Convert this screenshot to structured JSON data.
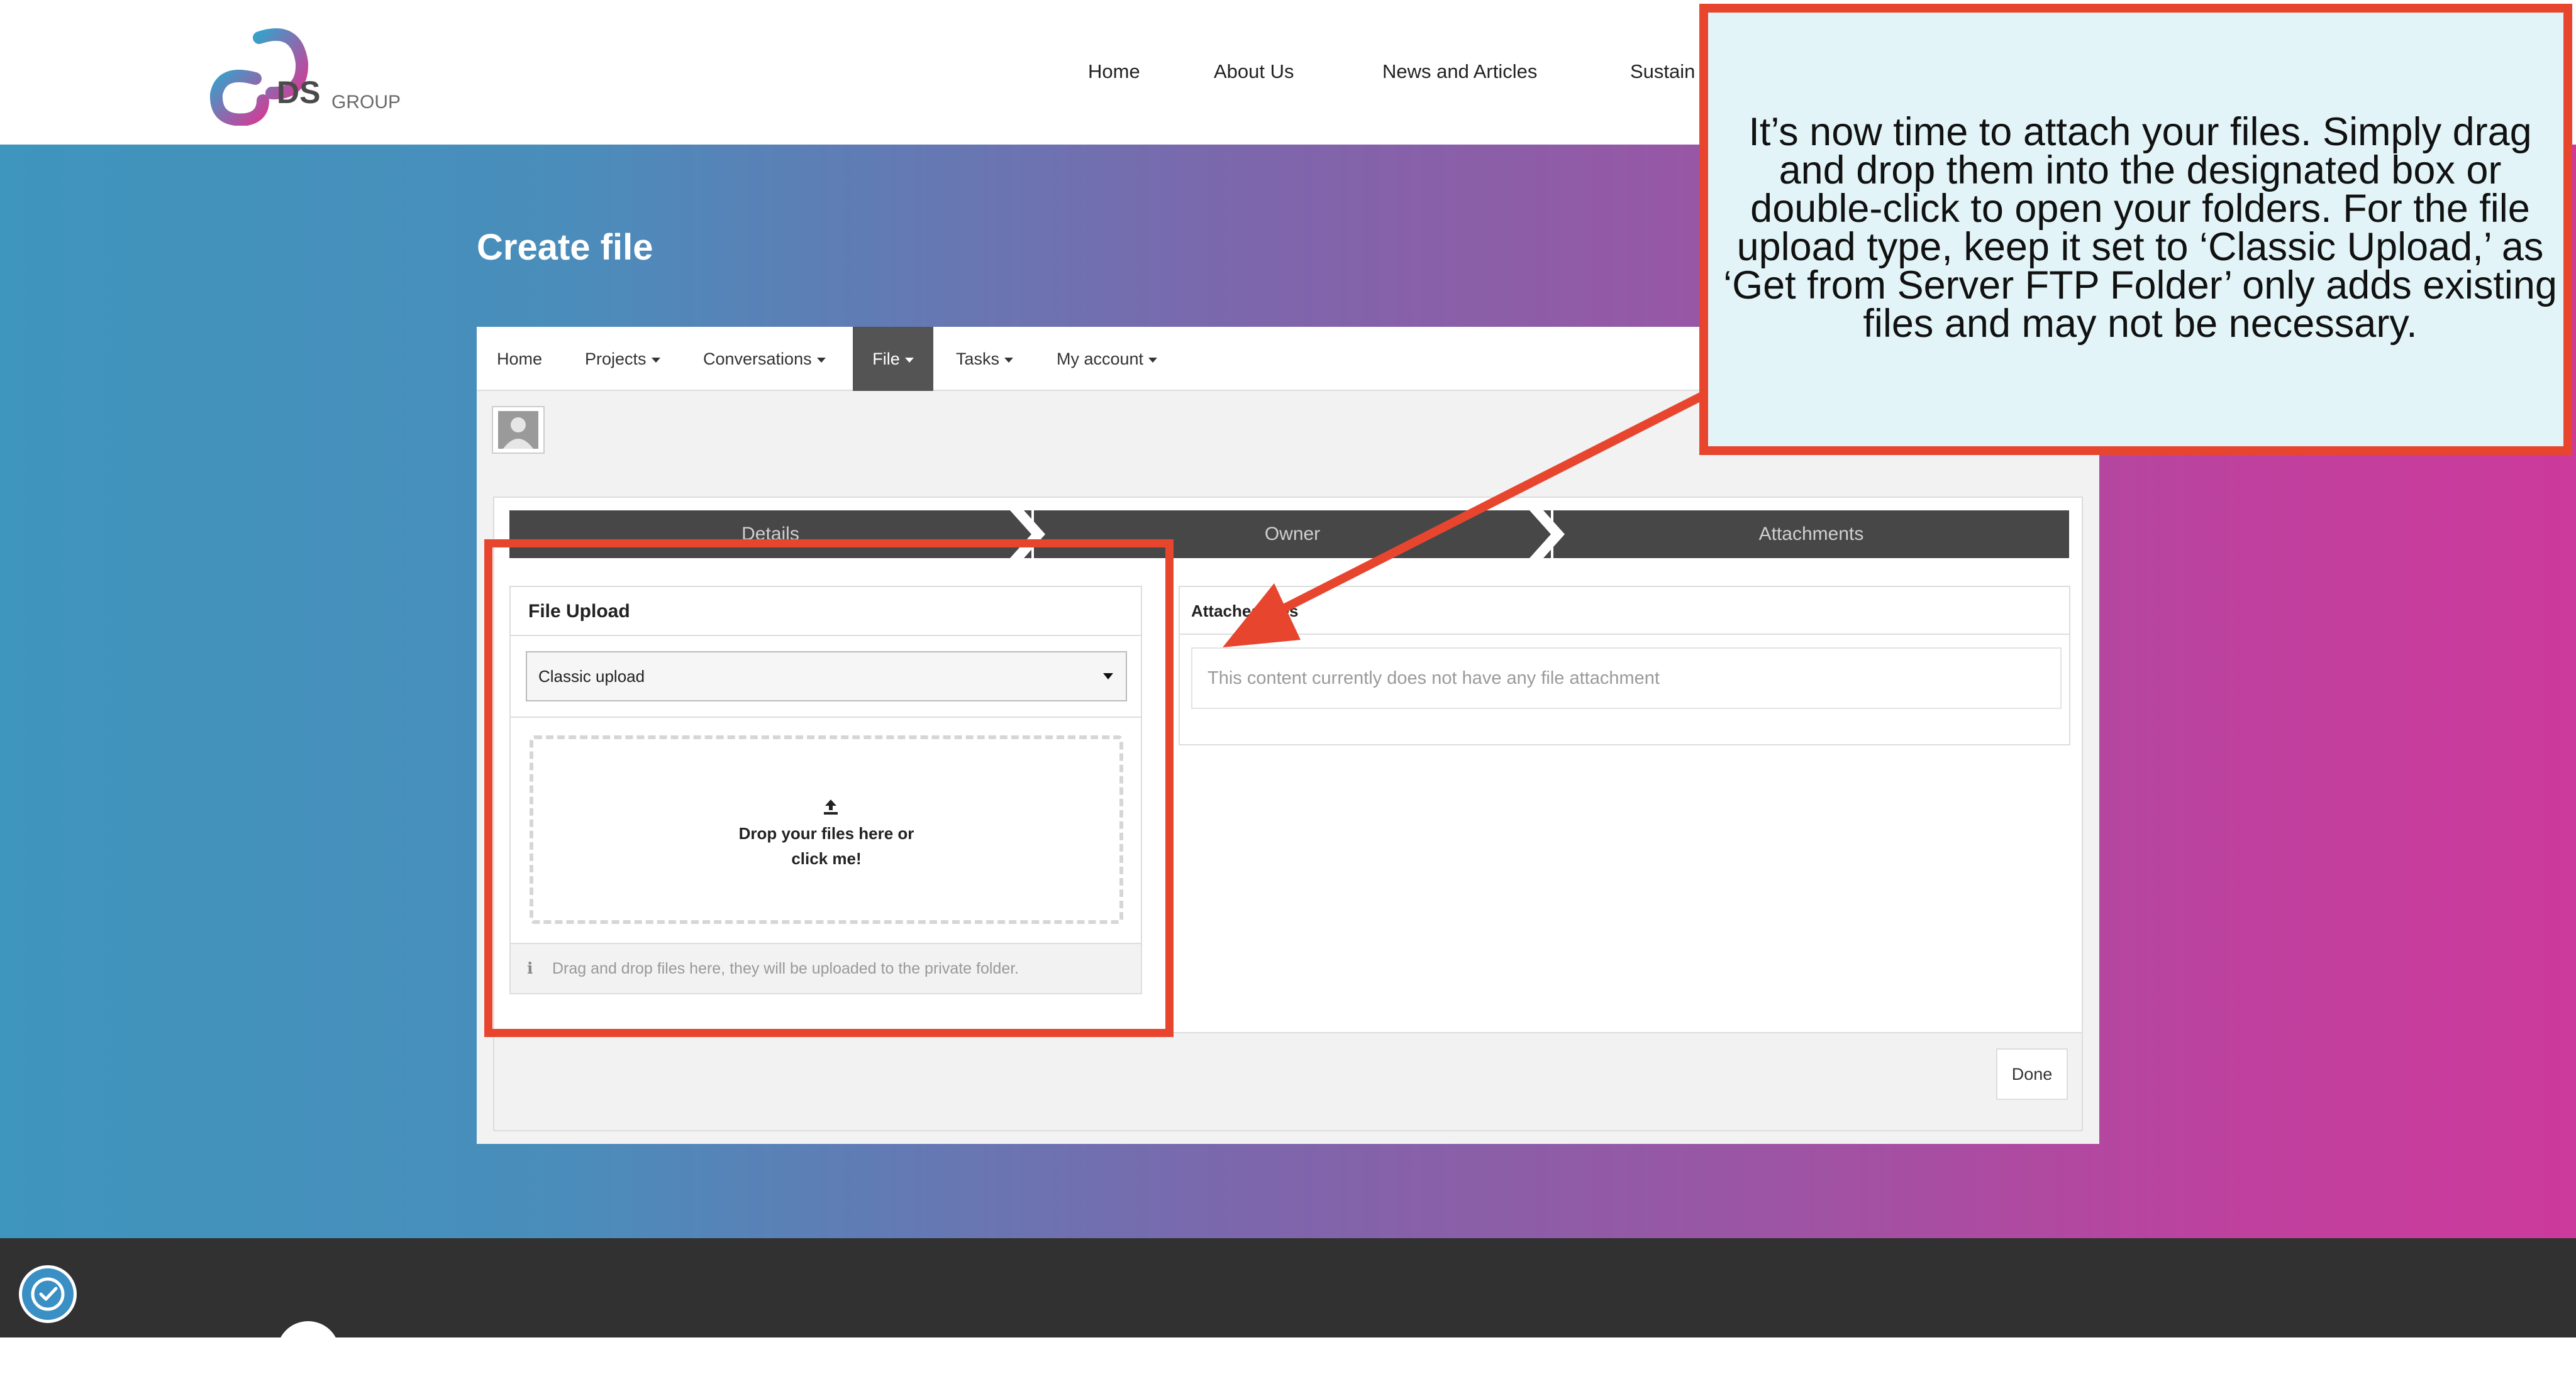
{
  "site": {
    "logo_text": "DS",
    "logo_subtext": "GROUP",
    "nav": [
      "Home",
      "About Us",
      "News and Articles",
      "Sustain"
    ]
  },
  "page": {
    "title": "Create file"
  },
  "app_nav": {
    "items": [
      "Home",
      "Projects",
      "Conversations",
      "File",
      "Tasks",
      "My account"
    ],
    "active": "File"
  },
  "wizard": {
    "steps": [
      "Details",
      "Owner",
      "Attachments"
    ]
  },
  "file_upload": {
    "header": "File Upload",
    "upload_type_selected": "Classic upload",
    "dropzone_text_line1": "Drop your files here or",
    "dropzone_text_line2": "click me!",
    "help_text": "Drag and drop files here, they will be uploaded to the private folder."
  },
  "attached_files": {
    "header": "Attached files",
    "empty_message": "This content currently does not have any file attachment"
  },
  "actions": {
    "done_label": "Done"
  },
  "callout": {
    "text": "It’s now time to attach your files. Simply drag and drop them into the designated box or double-click to open your folders. For the file upload type, keep it set to ‘Classic Upload,’ as ‘Get from Server FTP Folder’ only adds existing files and may not be necessary."
  },
  "colors": {
    "accent_red": "#e8452f",
    "callout_bg": "#e2f4f7",
    "active_nav_bg": "#545454",
    "step_bg": "#474747",
    "hero_gradient_start": "#3e95bd",
    "hero_gradient_end": "#cc3a9b",
    "footer_bg": "#313131"
  },
  "icons": {
    "upload": "upload-icon",
    "info": "info-icon",
    "avatar": "user-avatar-icon",
    "cookie": "cookie-settings-icon"
  }
}
